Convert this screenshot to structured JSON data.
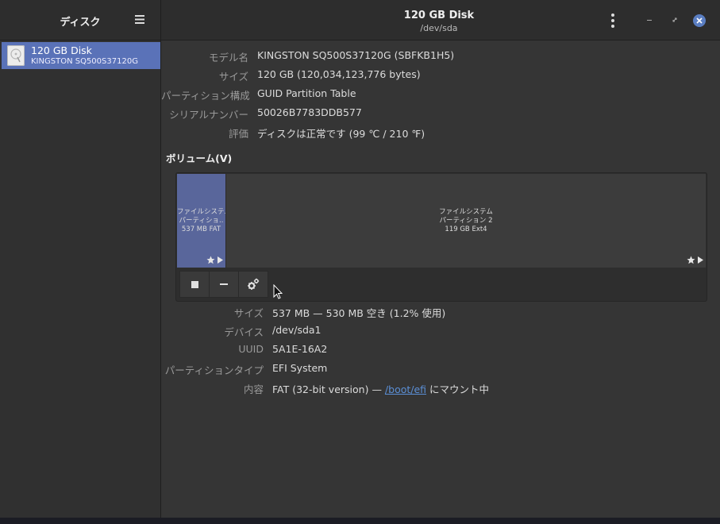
{
  "sidebar": {
    "title": "ディスク",
    "disks": [
      {
        "name": "120 GB Disk",
        "model": "KINGSTON SQ500S37120G"
      }
    ]
  },
  "header": {
    "title": "120 GB Disk",
    "subtitle": "/dev/sda"
  },
  "disk_info": {
    "model_label": "モデル名",
    "model_value": "KINGSTON SQ500S37120G (SBFKB1H5)",
    "size_label": "サイズ",
    "size_value": "120 GB (120,034,123,776 bytes)",
    "partitioning_label": "パーティション構成",
    "partitioning_value": "GUID Partition Table",
    "serial_label": "シリアルナンバー",
    "serial_value": "50026B7783DDB577",
    "assessment_label": "評価",
    "assessment_value": "ディスクは正常です (99 ℃ / 210 ℉)"
  },
  "volumes": {
    "heading": "ボリューム(V)",
    "partitions": [
      {
        "line1": "ファイルシステム",
        "line2": "パーティショ..",
        "line3": "537 MB FAT"
      },
      {
        "line1": "ファイルシステム",
        "line2": "パーティション 2",
        "line3": "119 GB Ext4"
      }
    ]
  },
  "partition_info": {
    "size_label": "サイズ",
    "size_value": "537 MB — 530 MB 空き (1.2% 使用)",
    "device_label": "デバイス",
    "device_value": "/dev/sda1",
    "uuid_label": "UUID",
    "uuid_value": "5A1E-16A2",
    "type_label": "パーティションタイプ",
    "type_value": "EFI System",
    "contents_label": "内容",
    "contents_prefix": "FAT (32-bit version) — ",
    "contents_link": "/boot/efi",
    "contents_suffix": " にマウント中"
  },
  "colors": {
    "accent": "#5a72b8",
    "selected_partition": "#59669b",
    "link": "#5b8fd6"
  }
}
